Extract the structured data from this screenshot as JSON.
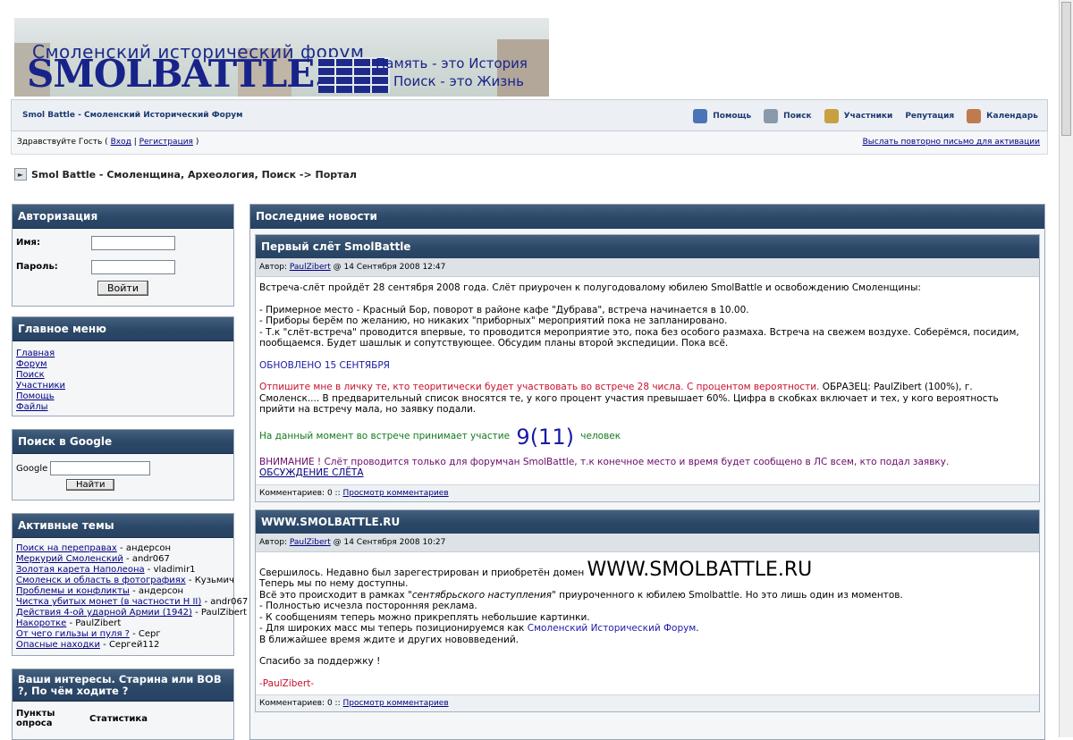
{
  "logo": {
    "tagline": "Смоленский исторический форум",
    "site": "SMOLBATTLE.RU",
    "slogan1": "Память - это История",
    "slogan2": "Поиск - это Жизнь"
  },
  "nav": {
    "site_link": "Smol Battle - Смоленский Исторический Форум",
    "items": [
      "Помощь",
      "Поиск",
      "Участники",
      "Репутация",
      "Календарь"
    ]
  },
  "welcome": {
    "greeting": "Здравствуйте Гость (",
    "login": "Вход",
    "sep": "|",
    "register": "Регистрация",
    "close": ")",
    "resend": "Выслать повторно письмо для активации"
  },
  "breadcrumb": "Smol Battle - Смоленщина, Археология, Поиск -> Портал",
  "auth": {
    "title": "Авторизация",
    "name_label": "Имя:",
    "pass_label": "Пароль:",
    "login_button": "Войти"
  },
  "main_menu": {
    "title": "Главное меню",
    "items": [
      "Главная",
      "Форум",
      "Поиск",
      "Участники",
      "Помощь",
      "Файлы"
    ]
  },
  "google": {
    "title": "Поиск в Google",
    "label": "Google",
    "button": "Найти"
  },
  "active": {
    "title": "Активные темы",
    "items": [
      {
        "topic": "Поиск на переправах",
        "author": "андерсон"
      },
      {
        "topic": "Меркурий Смоленский",
        "author": "andr067"
      },
      {
        "topic": "Золотая карета Наполеона",
        "author": "vladimir1"
      },
      {
        "topic": "Смоленск и область в фотографиях",
        "author": "Кузьмич"
      },
      {
        "topic": "Проблемы и конфликты",
        "author": "андерсон"
      },
      {
        "topic": "Чистка убитых монет (в частности Н II)",
        "author": "andr067"
      },
      {
        "topic": "Действия 4-ой ударной Армии (1942)",
        "author": "PaulZibert"
      },
      {
        "topic": "Накоротке",
        "author": "PaulZibert"
      },
      {
        "topic": "От чего гильзы и пуля ?",
        "author": "Серг"
      },
      {
        "topic": "Опасные находки",
        "author": "Сергей112"
      }
    ]
  },
  "poll": {
    "title": "Ваши интересы. Старина или ВОВ ?, По чём ходите ?",
    "col1": "Пункты опроса",
    "col2": "Статистика"
  },
  "news_title": "Последние новости",
  "news": [
    {
      "title": "Первый слёт SmolBattle",
      "author_prefix": "Автор:",
      "author": "PaulZibert",
      "date": "@ 14 Сентября 2008 12:47",
      "p1": "Встреча-слёт пройдёт 28 сентября 2008 года. Слёт приурочен к полугодовалому юбилею SmolBattle и освобождению Смоленщины:",
      "l1": "- Примерное место - Красный Бор, поворот в районе кафе \"Дубрава\", встреча начинается в 10.00.",
      "l2": "- Приборы берём по желанию, но никаких \"приборных\" мероприятий пока не запланировано.",
      "l3": "- Т.к \"слёт-встреча\" проводится впервые, то проводится мероприятие это, пока без особого размаха. Встреча на свежем воздухе. Соберёмся, посидим, пообщаемся. Будет шашлык и сопутствующее. Обсудим планы второй экспедиции. Пока всё.",
      "updated": "ОБНОВЛЕНО 15 СЕНТЯБРЯ",
      "red": "Отпишите мне в личку те, кто теоритически будет участвовать во встрече 28 числа. С процентом вероятности.",
      "rest": " ОБРАЗЕЦ: PaulZibert (100%), г. Смоленск.... В предварительный список вносятся те, у кого процент участия превышает 60%. Цифра в скобках включает и тех, у кого вероятность прийти на встречу мала, но заявку подали.",
      "green_pre": "На данный момент во встрече принимает участие ",
      "count": "9(11)",
      "green_post": " человек",
      "warning": "ВНИМАНИЕ ! Слёт проводится только для форумчан SmolBattle, т.к конечное место и время будет сообщено в ЛС всем, кто подал заявку.",
      "discussion": "ОБСУЖДЕНИЕ СЛЁТА",
      "comments": "Комментариев: 0 ::",
      "view": "Просмотр комментариев"
    },
    {
      "title": "WWW.SMOLBATTLE.RU",
      "author_prefix": "Автор:",
      "author": "PaulZibert",
      "date": "@ 14 Сентября 2008 10:27",
      "p1_pre": "Свершилось. Недавно был зарегестрирован и приобретён домен ",
      "domain": "WWW.SMOLBATTLE.RU",
      "l1": "Теперь мы по нему доступны.",
      "l2_pre": "Всё это происходит в рамках \"",
      "l2_em": "сентябрьского наступления",
      "l2_post": "\" приуроченного к юбилею Smolbattle. Но это лишь один из моментов.",
      "l3": "- Полностью исчезла посторонняя реклама.",
      "l4": "- К сообщениям теперь можно прикреплять небольшие картинки.",
      "l5_pre": "- Для широких масс мы теперь позиционируемся как ",
      "l5_link": "Смоленский Исторический Форум",
      "l5_post": ".",
      "l6": "В ближайшее время ждите и других нововведений.",
      "thanks": "Спасибо за поддержку !",
      "sign": "-PaulZibert-",
      "comments": "Комментариев: 0 ::",
      "view": "Просмотр комментариев"
    }
  ]
}
